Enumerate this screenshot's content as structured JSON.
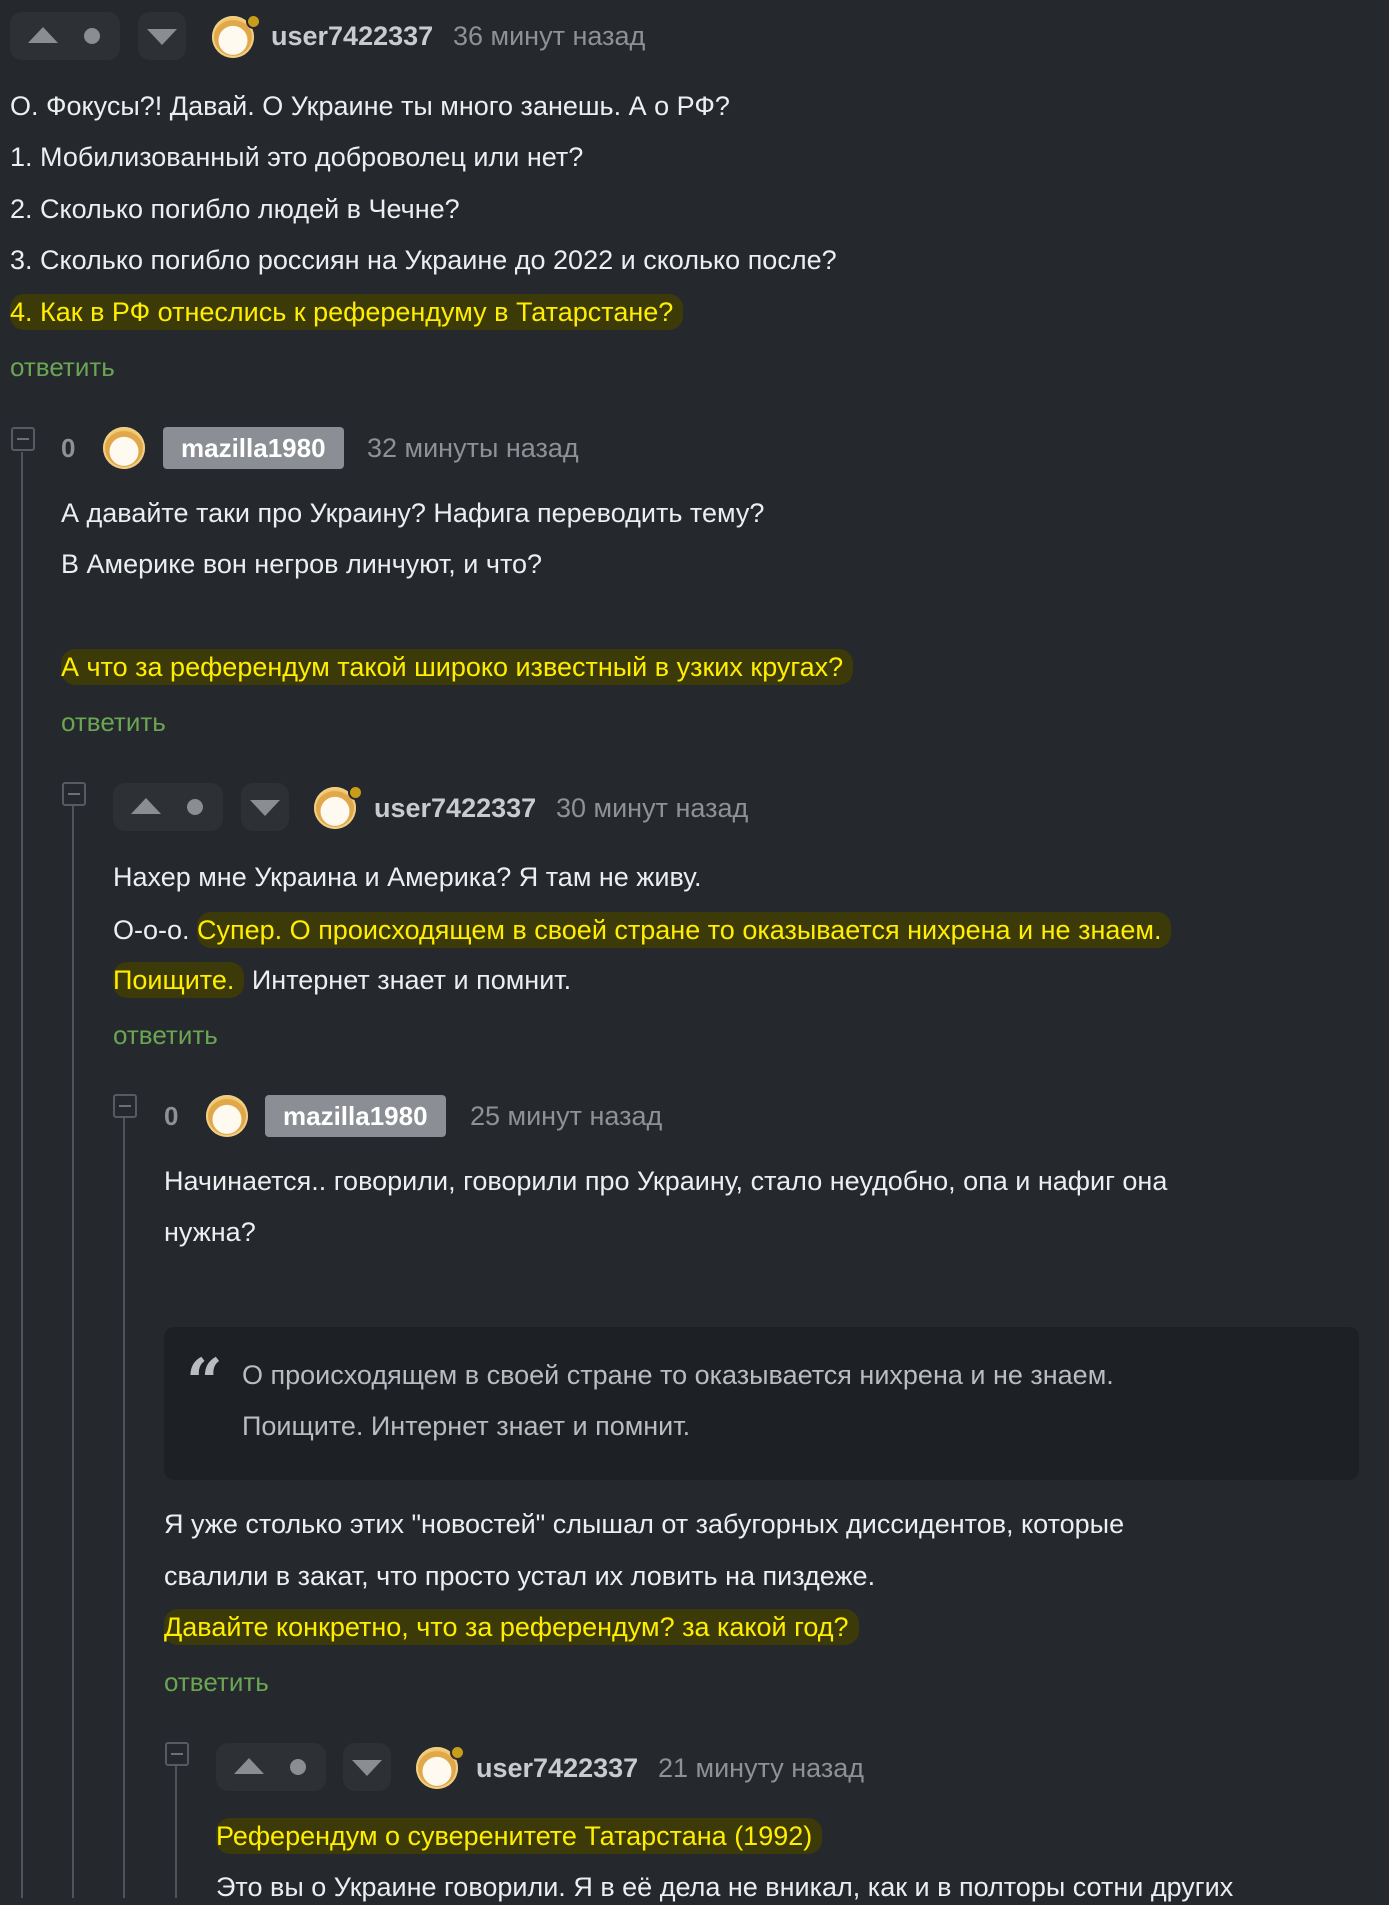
{
  "comments": {
    "c1": {
      "username": "user7422337",
      "time": "36 минут назад",
      "lines": [
        "О. Фокусы?! Давай. О Украине ты много занешь. А о РФ?",
        "1. Мобилизованный это доброволец или нет?",
        "2. Сколько погибло людей в Чечне?",
        "3. Сколько погибло россиян на Украине до 2022 и сколько после?",
        "4. Как в РФ отнеслись к референдуму в Татарстане?"
      ],
      "reply": "ответить"
    },
    "c2": {
      "score": "0",
      "username": "mazilla1980",
      "time": "32 минуты назад",
      "lines": [
        "А давайте таки про Украину? Нафига переводить тему?",
        "В Америке вон негров линчуют, и что?",
        "А что за референдум такой широко известный в узких кругах?"
      ],
      "reply": "ответить"
    },
    "c3": {
      "username": "user7422337",
      "time": "30 минут назад",
      "line1": "Нахер мне Украина и Америка? Я там не живу.",
      "line2_plain": "О-о-о. ",
      "line2_hl": "Супер. О происходящем в своей стране то оказывается нихрена и не знаем.",
      "line3_hl": "Поищите.",
      "line3_plain": " Интернет знает и помнит.",
      "reply": "ответить"
    },
    "c4": {
      "score": "0",
      "username": "mazilla1980",
      "time": "25 минут назад",
      "lines": [
        "Начинается.. говорили, говорили про Украину, стало неудобно, опа и нафиг она",
        "нужна?"
      ],
      "quote_mark": "“",
      "quote": [
        "О происходящем в своей стране то оказывается нихрена и не знаем.",
        "Поищите. Интернет знает и помнит."
      ],
      "after": [
        "Я уже столько этих \"новостей\" слышал от забугорных диссидентов, которые",
        "свалили в закат, что просто устал их ловить на пиздеже.",
        "Давайте конкретно, что за референдум? за какой год?"
      ],
      "reply": "ответить"
    },
    "c5": {
      "username": "user7422337",
      "time": "21 минуту назад",
      "lines": [
        "Референдум о суверенитете Татарстана (1992)",
        "Это вы о Украине говорили. Я в её дела не вникал, как и в полторы сотни других"
      ]
    }
  },
  "colors": {
    "background": "#25282c",
    "highlight_text": "#ffee00",
    "reply_link": "#6aa553",
    "badge": "#8b8e94"
  }
}
